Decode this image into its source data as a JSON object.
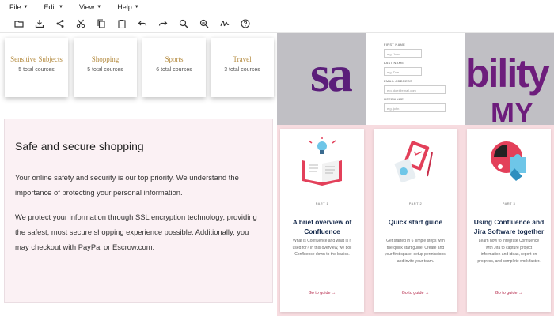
{
  "menubar": {
    "items": [
      {
        "label": "File"
      },
      {
        "label": "Edit"
      },
      {
        "label": "View"
      },
      {
        "label": "Help"
      }
    ]
  },
  "toolbar": {
    "tools": [
      "folder-icon",
      "download-icon",
      "share-icon",
      "cut-icon",
      "copy-icon",
      "paste-icon",
      "undo-icon",
      "redo-icon",
      "zoom-in-icon",
      "zoom-out-icon",
      "signature-icon",
      "help-icon"
    ]
  },
  "courses": [
    {
      "name": "Sensitive Subjects",
      "count": "5 total courses"
    },
    {
      "name": "Shopping",
      "count": "5 total courses"
    },
    {
      "name": "Sports",
      "count": "6 total courses"
    },
    {
      "name": "Travel",
      "count": "3 total courses"
    }
  ],
  "secure": {
    "title": "Safe and secure shopping",
    "p1": "Your online safety and security is our top priority. We understand the importance of protecting your personal information.",
    "p2": "We protect your information through SSL encryption technology, providing the safest, most secure shopping experience possible. Additionally, you may checkout with PayPal or Escrow.com."
  },
  "banner": {
    "logo_left": "sa",
    "logo_right": "bility",
    "logo_right2": "MY"
  },
  "form": {
    "fields": [
      {
        "label": "FIRST NAME",
        "placeholder": "e.g. John"
      },
      {
        "label": "LAST NAME",
        "placeholder": "e.g. Doe"
      },
      {
        "label": "EMAIL ADDRESS",
        "placeholder": "e.g. doe@email.com"
      },
      {
        "label": "USERNAME",
        "placeholder": "e.g. john"
      }
    ]
  },
  "guides": [
    {
      "part": "PART 1",
      "title": "A brief overview of Confluence",
      "desc": "What is Confluence and what is it used for? In this overview, we boil Confluence down to the basics.",
      "link": "Go to guide →"
    },
    {
      "part": "PART 2",
      "title": "Quick start guide",
      "desc": "Get started in 6 simple steps with the quick start guide. Create and your first space, setup permissions, and invite your team.",
      "link": "Go to guide →"
    },
    {
      "part": "PART 3",
      "title": "Using Confluence and Jira Software together",
      "desc": "Learn how to integrate Confluence with Jira to capture project information and ideas, report on progress, and complete work faster.",
      "link": "Go to guide →"
    }
  ],
  "colors": {
    "accent": "#b48a3e",
    "link": "#b5284a",
    "banner_purple": "#5b1e7a",
    "panel_pink": "#f7dce0"
  }
}
